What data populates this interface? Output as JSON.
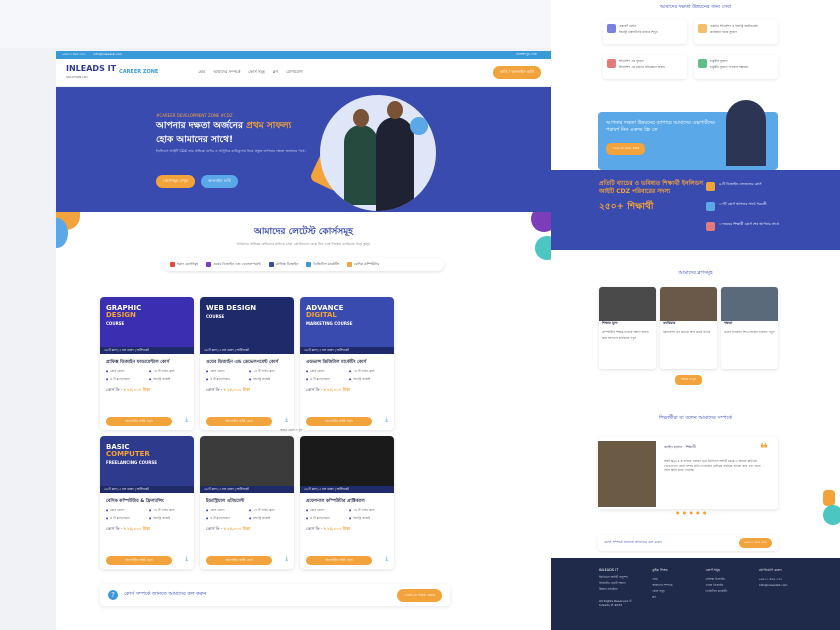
{
  "left": {
    "topbar": {
      "phone": "০৯৬১৩ ৪৬৬ ৩৩৩",
      "email": "info@inleadsit.com",
      "address": "মোহাম্মদপুর, ঢাকা"
    },
    "logo": {
      "name": "INLEADS IT",
      "sub": "SOLUTION LTD.",
      "zone": "CAREER ZONE"
    },
    "nav": [
      "হোম",
      "আমাদের সম্পর্কে",
      "কোর্স সমূহ",
      "ব্লগ",
      "যোগাযোগ"
    ],
    "nav_button": "ভর্তি / অনলাইন ভর্তি",
    "hero": {
      "tag": "#CAREER DEVELOPMENT ZONE #CDZ",
      "title_a": "আপনার দক্ষতা অর্জনের ",
      "title_b": "প্রথম সাফল্য",
      "title_c": "হোক আমাদের সাথে!",
      "sub": "ইনলিডস আইটি CDZ তার অভিজ্ঞ মেন্টর ও আধুনিক কারিকুলাম নিয়ে প্রস্তুত আপনার দক্ষতা অর্জনের পথে।",
      "btn1": "কোর্সসমূহ দেখুন",
      "btn2": "অনলাইন ভর্তি"
    },
    "courses": {
      "title": "আমাদের লেটেস্ট কোর্সসমূহ",
      "subtitle": "আমাদের অভিজ্ঞ মেন্টরদের মাধ্যমে সেরা কোর্সগুলো বেছে নিন এবং নিজের ক্যারিয়ার গড়ে তুলুন",
      "tabs": [
        "সকল কোর্সসমূহ",
        "ওয়েব ডিজাইন এন্ড ডেভেলপমেন্ট",
        "গ্রাফিক্স ডিজাইন",
        "ডিজিটাল মার্কেটিং",
        "বেসিক কম্পিউটার"
      ],
      "items": [
        {
          "t1": "GRAPHIC",
          "t2": "DESIGN",
          "t3": "COURSE",
          "bar": "৩৬ টি ক্লাস | ৩ মাস মেয়াদ | সার্টিফিকেট",
          "title": "গ্রাফিক্স ডিজাইন ফান্ডামেন্টাল কোর্স",
          "m1": "কোর্স মেয়াদ",
          "m2": "১৪ টি লাইভ ক্লাস",
          "m3": "৪ টি ক্লাস/সপ্তাহ",
          "m4": "ইন্ডাস্ট্রি প্রজেক্ট",
          "fee": "কোর্স ফি - ",
          "price": "৳ ১৫,০০০ টাকা",
          "cta": "অনলাইন ভর্তি হোন"
        },
        {
          "t1": "WEB DESIGN",
          "t2": "",
          "t3": "COURSE",
          "bar": "৩৬ টি ক্লাস | ৩ মাস মেয়াদ | সার্টিফিকেট",
          "title": "ওয়েব ডিজাইন এন্ড ডেভেলপমেন্ট কোর্স",
          "m1": "কোর্স মেয়াদ",
          "m2": "১৪ টি লাইভ ক্লাস",
          "m3": "৪ টি ক্লাস/সপ্তাহ",
          "m4": "ইন্ডাস্ট্রি প্রজেক্ট",
          "fee": "কোর্স ফি - ",
          "price": "৳ ১৫,০০০ টাকা",
          "cta": "অনলাইন ভর্তি হোন"
        },
        {
          "t1": "ADVANCE",
          "t2": "DIGITAL",
          "t3": "MARKETING COURSE",
          "bar": "৩৬ টি ক্লাস | ৩ মাস মেয়াদ | সার্টিফিকেট",
          "title": "এডভান্স ডিজিটাল মার্কেটিং কোর্স",
          "m1": "কোর্স মেয়াদ",
          "m2": "১৪ টি লাইভ ক্লাস",
          "m3": "৪ টি ক্লাস/সপ্তাহ",
          "m4": "ইন্ডাস্ট্রি প্রজেক্ট",
          "fee": "কোর্স ফি - ",
          "price": "৳ ১৫,০০০ টাকা",
          "cta": "অনলাইন ভর্তি হোন"
        },
        {
          "t1": "BASIC",
          "t2": "COMPUTER",
          "t3": "FREELANCING COURSE",
          "bar": "৩৬ টি ক্লাস | ৩ মাস মেয়াদ | সার্টিফিকেট",
          "title": "বেসিক কম্পিউটার & ফ্রিল্যান্সিং",
          "m1": "কোর্স মেয়াদ",
          "m2": "১৪ টি লাইভ ক্লাস",
          "m3": "৪ টি ক্লাস/সপ্তাহ",
          "m4": "ইন্ডাস্ট্রি প্রজেক্ট",
          "fee": "কোর্স ফি - ",
          "price": "৳ ১৫,০০০ টাকা",
          "cta": "অনলাইন ভর্তি হোন"
        },
        {
          "t1": "",
          "t2": "",
          "t3": "",
          "bar": "৩৬ টি ক্লাস | ৩ মাস মেয়াদ | সার্টিফিকেট",
          "title": "ইন্ডাস্ট্রিয়াল এটাচমেন্ট",
          "m1": "কোর্স মেয়াদ",
          "m2": "১৪ টি লাইভ ক্লাস",
          "m3": "৪ টি ক্লাস/সপ্তাহ",
          "m4": "ইন্ডাস্ট্রি প্রজেক্ট",
          "fee": "কোর্স ফি - ",
          "price": "৳ ১৫,০০০ টাকা",
          "cta": "অনলাইন ভর্তি হোন"
        },
        {
          "t1": "",
          "t2": "",
          "t3": "",
          "bar": "৩৬ টি ক্লাস | ৩ মাস মেয়াদ | সার্টিফিকেট",
          "title": "প্রফেশনাল কম্পিউটার প্রাক্টিক্যাল",
          "m1": "কোর্স মেয়াদ",
          "m2": "১৪ টি লাইভ ক্লাস",
          "m3": "৪ টি ক্লাস/সপ্তাহ",
          "m4": "ইন্ডাস্ট্রি প্রজেক্ট",
          "fee": "কোর্স ফি - ",
          "price": "৳ ১৫,০০০ টাকা",
          "cta": "অনলাইন ভর্তি হোন"
        }
      ],
      "see_more": "আরও কোর্স দেখুন"
    },
    "cta": {
      "text": "কোর্স সম্পর্কে জানতে আমাদের কল করুন",
      "button": "০৯৬১৩ ৪৬৬ ৩৩৩"
    }
  },
  "right": {
    "features_title": "আমাদের দক্ষতা উন্নয়নের জন্য সেবা",
    "features": [
      {
        "t": "এক্সপার্ট মেন্টর",
        "d": "ইন্ডাস্ট্রি এক্সপার্টদের মাধ্যমে শিখুন"
      },
      {
        "t": "এপ্লাইড ইন্টার্নশিপ ও ইন্ডাস্ট্রি অ্যাটাচমেন্ট",
        "d": "ক্যারিয়ার গড়ার সুযোগ"
      },
      {
        "t": "ইন্টার্নশিপ এর সুযোগ",
        "d": "ইন্টার্নশিপ এর মাধ্যমে অভিজ্ঞতা অর্জন"
      },
      {
        "t": "চাকুরীর সুযোগ",
        "d": "চাকুরীর সুযোগ পাওয়ার সম্ভাবনা"
      }
    ],
    "promo": {
      "text": "আপনার দক্ষতা উন্নয়নের ব্যাপারে আমাদের এক্সপার্টদের পরামর্শ নিন একদম ফ্রি তে",
      "button": "০৯৬১৩ ৪৬৬ ৩৩৩"
    },
    "stats": {
      "text": "প্রতিটি ব্যাচের ও ভবিষ্যত শিক্ষার্থী ইনলিডস আইটি CDZ পরিবারের সদস্য",
      "count": "২৫০+ শিক্ষার্থী",
      "items": [
        "৬ টি ডিজাইন লেভেলের কোর্স",
        "১০টি কোর্স আপনার সাথে পরবর্তী",
        "১০জনের শিক্ষার্থী কোর্স শেষ আপনার সাথে",
        "এক্সপার্ট মেন্টর"
      ]
    },
    "blog": {
      "title": "আমাদের ব্লগসমূহ",
      "items": [
        {
          "t": "শিক্ষার মূল্য",
          "d": "কম্পিউটার শিক্ষার মাধ্যমে দক্ষতা অর্জন করে আপনার ক্যারিয়ার গড়ুন"
        },
        {
          "t": "ক্যারিয়ার",
          "d": "ফ্রিল্যান্সিং এর মাধ্যমে আয় করার উপায়"
        },
        {
          "t": "দক্ষতা",
          "d": "ওয়েব ডিজাইন শিখে নিজের ভবিষ্যৎ গড়ুন"
        }
      ],
      "button": "আরও দেখুন"
    },
    "testimonial": {
      "title": "শিক্ষার্থীরা যা বলেন আমাদের সম্পর্কে",
      "name": "জাহিদ হাসান",
      "role": "শিক্ষার্থী",
      "text": "আমি Nyx 1.3 ব্যাচের একজন ছাত্র ইনলিডস আইটি CDZ এ আমার ফ্রন্টএন্ড ডেভেলপার কোর্স সম্পন্ন করি। এখানকার মেন্টররা সবসময় সাহায্য করে এবং কোর্স শেষে আমি কাজ পেয়েছি।"
    },
    "cta": {
      "text": "কোর্স সম্পর্কে জানতে আমাদের কল করুন",
      "button": "০৯৬১৩ ৪৬৬ ৩৩৩"
    },
    "footer": {
      "about": "ইনলিডস আইটি সল্যুশন লিমিটেড একটি দক্ষতা উন্নয়ন প্রতিষ্ঠান",
      "col1_title": "কুইক লিংক",
      "col1": [
        "হোম",
        "আমাদের সম্পর্কে",
        "কোর্স সমূহ",
        "ব্লগ"
      ],
      "col2_title": "কোর্স সমূহ",
      "col2": [
        "গ্রাফিক্স ডিজাইন",
        "ওয়েব ডিজাইন",
        "ডিজিটাল মার্কেটিং"
      ],
      "col3_title": "যোগাযোগ করুন",
      "col3": [
        "০৯৬১৩ ৪৬৬ ৩৩৩",
        "info@inleadsit.com"
      ],
      "copyright": "All Rights Reserved © Inleads IT 2023"
    }
  }
}
